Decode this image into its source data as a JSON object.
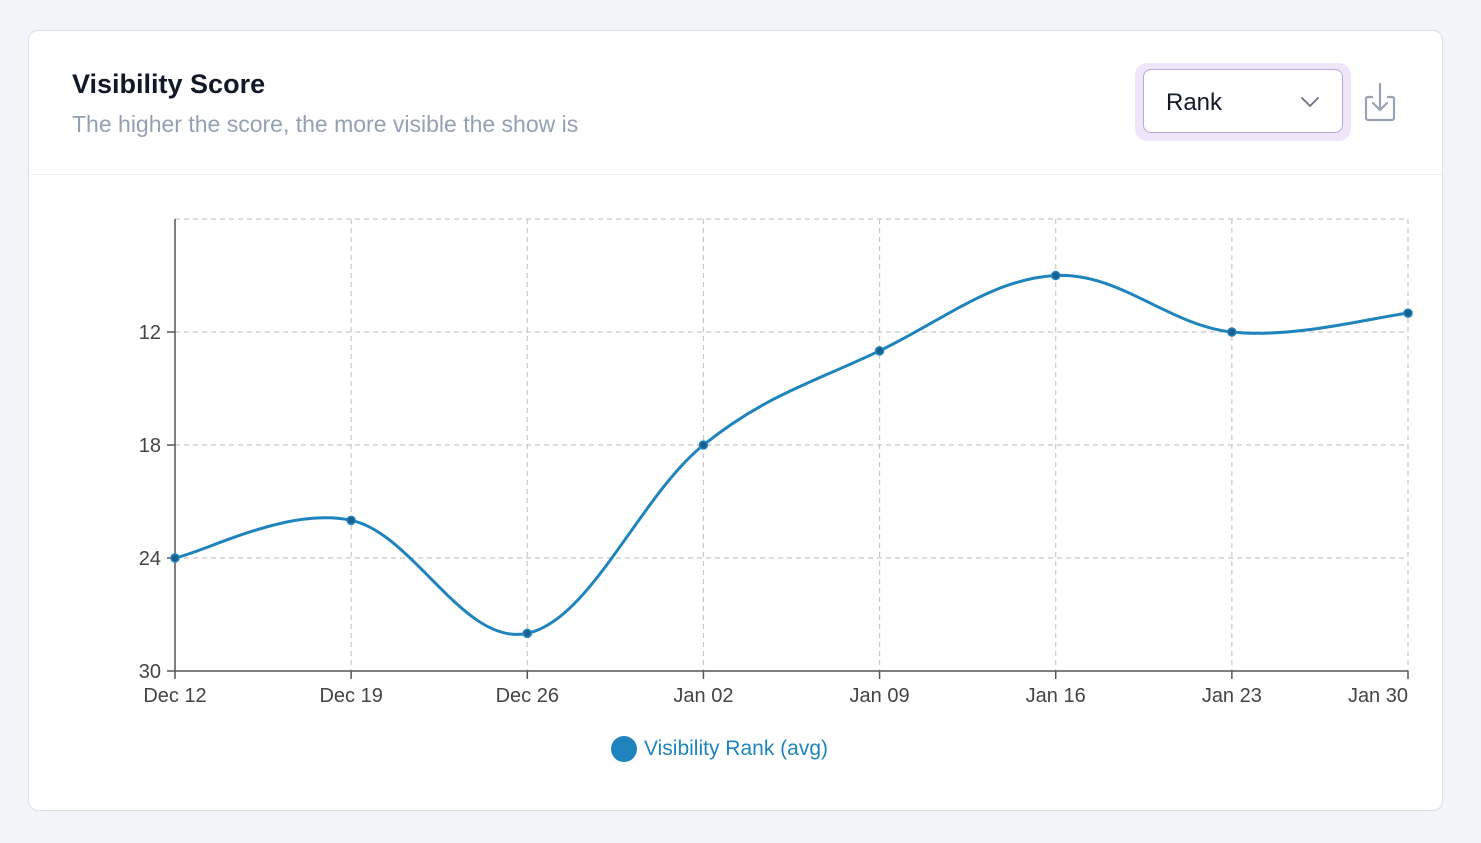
{
  "header": {
    "title": "Visibility Score",
    "subtitle": "The higher the score, the more visible the show is"
  },
  "controls": {
    "metric_select_value": "Rank",
    "chevron_icon": "chevron-down-icon",
    "download_icon": "download-icon"
  },
  "colors": {
    "series": "#1f84bd",
    "series_point": "#1a5f8e",
    "grid": "#c8c8c8",
    "axis": "#555555",
    "select_border": "#b7a6d8",
    "select_halo": "#efe6fb"
  },
  "chart_data": {
    "type": "line",
    "smooth": true,
    "x": [
      "Dec 12",
      "Dec 19",
      "Dec 26",
      "Jan 02",
      "Jan 09",
      "Jan 16",
      "Jan 23",
      "Jan 30"
    ],
    "series": [
      {
        "name": "Visibility Rank (avg)",
        "values": [
          24,
          22,
          28,
          18,
          13,
          9,
          12,
          11
        ]
      }
    ],
    "y_ticks": [
      12,
      18,
      24,
      30
    ],
    "ylim": [
      30,
      6
    ],
    "y_reversed": true,
    "grid": true,
    "legend": "bottom-center"
  }
}
